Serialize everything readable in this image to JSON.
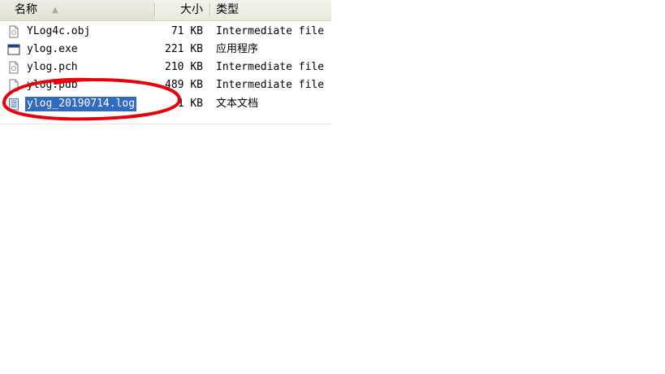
{
  "columns": {
    "name": "名称",
    "size": "大小",
    "type": "类型"
  },
  "files": [
    {
      "name": "YLog4c.obj",
      "size": "71 KB",
      "type": "Intermediate file",
      "icon": "generic-file-icon"
    },
    {
      "name": "ylog.exe",
      "size": "221 KB",
      "type": "应用程序",
      "icon": "exe-window-icon"
    },
    {
      "name": "ylog.pch",
      "size": "210 KB",
      "type": "Intermediate file",
      "icon": "generic-file-icon"
    },
    {
      "name": "ylog.pdb",
      "size": "489 KB",
      "type": "Intermediate file",
      "icon": "generic-file-icon"
    },
    {
      "name": "ylog_20190714.log",
      "size": "1 KB",
      "type": "文本文档",
      "icon": "text-document-icon",
      "selected": true
    }
  ],
  "colors": {
    "selection": "#316ac5",
    "annotation": "#e8000b",
    "header_bg": "#ebeadb"
  }
}
